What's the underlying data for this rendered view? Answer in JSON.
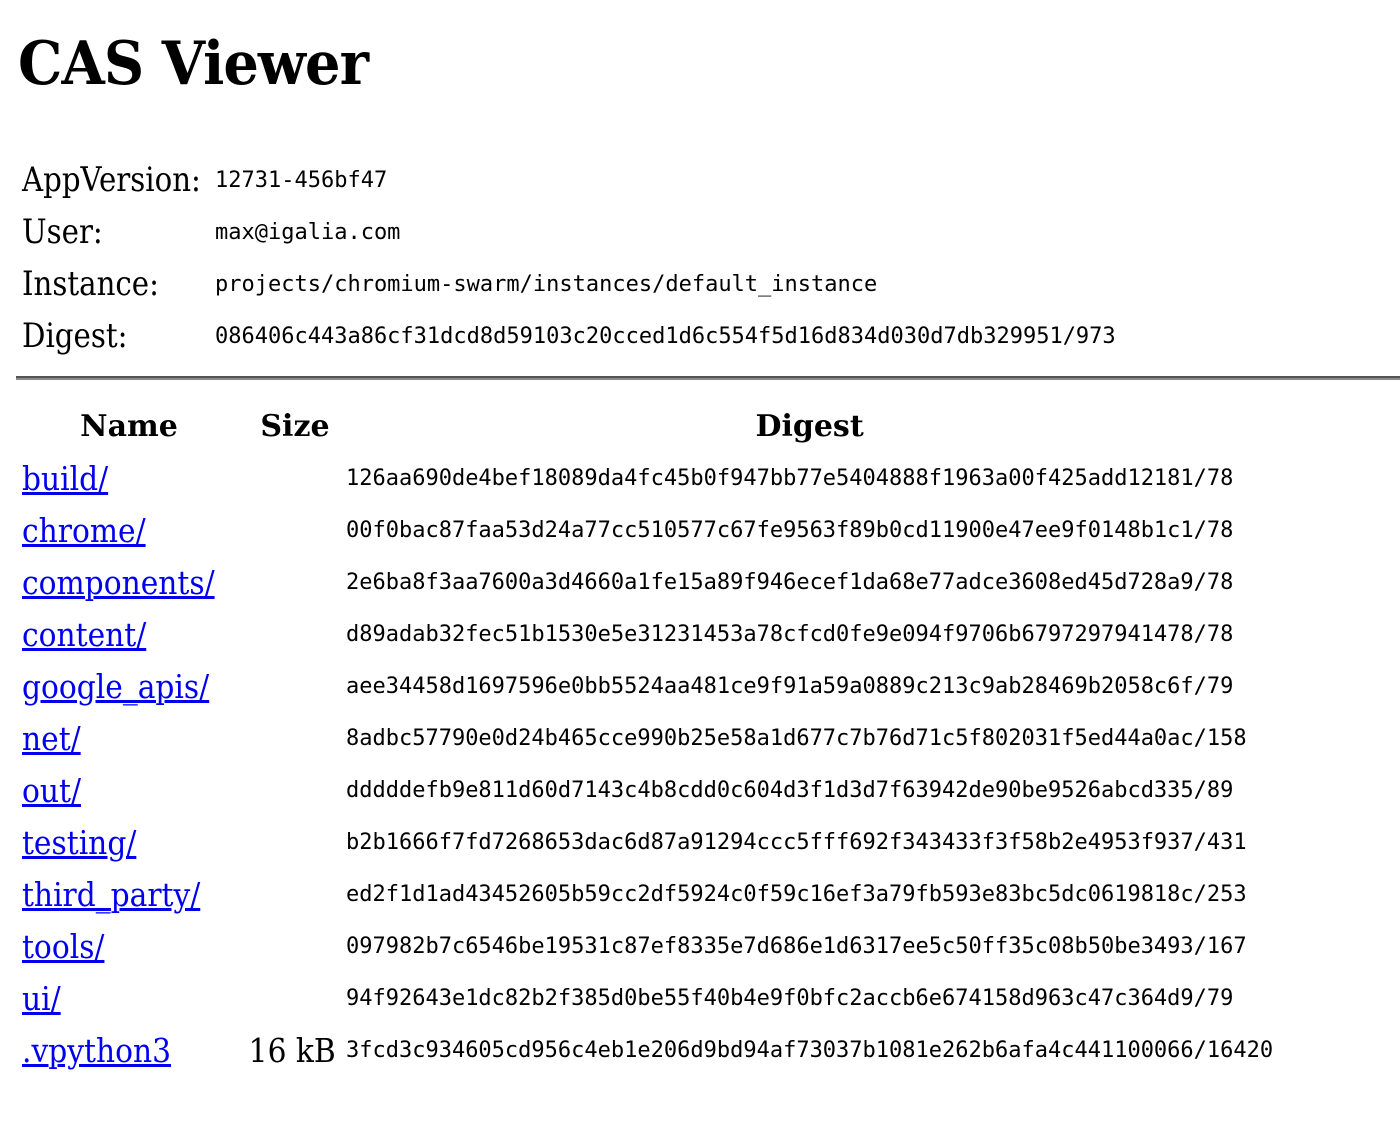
{
  "page": {
    "title": "CAS Viewer"
  },
  "info": {
    "app_version_label": "AppVersion:",
    "app_version": "12731-456bf47",
    "user_label": "User:",
    "user": "max@igalia.com",
    "instance_label": "Instance:",
    "instance": "projects/chromium-swarm/instances/default_instance",
    "digest_label": "Digest:",
    "digest": "086406c443a86cf31dcd8d59103c20cced1d6c554f5d16d834d030d7db329951/973"
  },
  "table": {
    "headers": {
      "name": "Name",
      "size": "Size",
      "digest": "Digest"
    },
    "rows": [
      {
        "name": "build/",
        "size": "",
        "digest": "126aa690de4bef18089da4fc45b0f947bb77e5404888f1963a00f425add12181/78"
      },
      {
        "name": "chrome/",
        "size": "",
        "digest": "00f0bac87faa53d24a77cc510577c67fe9563f89b0cd11900e47ee9f0148b1c1/78"
      },
      {
        "name": "components/",
        "size": "",
        "digest": "2e6ba8f3aa7600a3d4660a1fe15a89f946ecef1da68e77adce3608ed45d728a9/78"
      },
      {
        "name": "content/",
        "size": "",
        "digest": "d89adab32fec51b1530e5e31231453a78cfcd0fe9e094f9706b6797297941478/78"
      },
      {
        "name": "google_apis/",
        "size": "",
        "digest": "aee34458d1697596e0bb5524aa481ce9f91a59a0889c213c9ab28469b2058c6f/79"
      },
      {
        "name": "net/",
        "size": "",
        "digest": "8adbc57790e0d24b465cce990b25e58a1d677c7b76d71c5f802031f5ed44a0ac/158"
      },
      {
        "name": "out/",
        "size": "",
        "digest": "dddddefb9e811d60d7143c4b8cdd0c604d3f1d3d7f63942de90be9526abcd335/89"
      },
      {
        "name": "testing/",
        "size": "",
        "digest": "b2b1666f7fd7268653dac6d87a91294ccc5fff692f343433f3f58b2e4953f937/431"
      },
      {
        "name": "third_party/",
        "size": "",
        "digest": "ed2f1d1ad43452605b59cc2df5924c0f59c16ef3a79fb593e83bc5dc0619818c/253"
      },
      {
        "name": "tools/",
        "size": "",
        "digest": "097982b7c6546be19531c87ef8335e7d686e1d6317ee5c50ff35c08b50be3493/167"
      },
      {
        "name": "ui/",
        "size": "",
        "digest": "94f92643e1dc82b2f385d0be55f40b4e9f0bfc2accb6e674158d963c47c364d9/79"
      },
      {
        "name": ".vpython3",
        "size": "16 kB",
        "digest": "3fcd3c934605cd956c4eb1e206d9bd94af73037b1081e262b6afa4c441100066/16420"
      }
    ]
  },
  "colors": {
    "link": "#0000ee",
    "divider": "#555555"
  }
}
